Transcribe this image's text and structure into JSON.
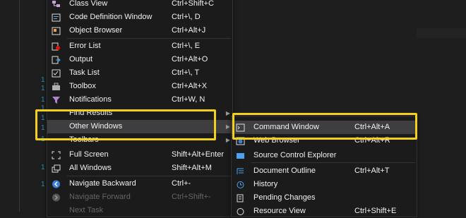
{
  "editor": {
    "line_markers": [
      "1",
      "1",
      "1",
      "1",
      "1",
      "1",
      "1",
      "1",
      "1"
    ]
  },
  "main_menu": {
    "items": [
      {
        "label": "Class View",
        "shortcut": "Ctrl+Shift+C",
        "icon": "class-view-icon"
      },
      {
        "label": "Code Definition Window",
        "shortcut": "Ctrl+\\, D",
        "icon": "code-definition-icon"
      },
      {
        "label": "Object Browser",
        "shortcut": "Ctrl+Alt+J",
        "icon": "object-browser-icon"
      },
      {
        "label": "Error List",
        "shortcut": "Ctrl+\\, E",
        "icon": "error-list-icon"
      },
      {
        "label": "Output",
        "shortcut": "Ctrl+Alt+O",
        "icon": "output-icon"
      },
      {
        "label": "Task List",
        "shortcut": "Ctrl+\\, T",
        "icon": "task-list-icon"
      },
      {
        "label": "Toolbox",
        "shortcut": "Ctrl+Alt+X",
        "icon": "toolbox-icon"
      },
      {
        "label": "Notifications",
        "shortcut": "Ctrl+W, N",
        "icon": "notifications-icon"
      },
      {
        "label": "Find Results",
        "shortcut": "",
        "icon": ""
      },
      {
        "label": "Other Windows",
        "shortcut": "",
        "icon": ""
      },
      {
        "label": "Toolbars",
        "shortcut": "",
        "icon": ""
      },
      {
        "label": "Full Screen",
        "shortcut": "Shift+Alt+Enter",
        "icon": "full-screen-icon"
      },
      {
        "label": "All Windows",
        "shortcut": "Shift+Alt+M",
        "icon": "all-windows-icon"
      },
      {
        "label": "Navigate Backward",
        "shortcut": "Ctrl+-",
        "icon": "navigate-backward-icon"
      },
      {
        "label": "Navigate Forward",
        "shortcut": "Ctrl+Shift+-",
        "icon": "navigate-forward-icon"
      },
      {
        "label": "Next Task",
        "shortcut": "",
        "icon": ""
      }
    ]
  },
  "sub_menu": {
    "items": [
      {
        "label": "Command Window",
        "shortcut": "Ctrl+Alt+A",
        "icon": "command-window-icon"
      },
      {
        "label": "Web Browser",
        "shortcut": "Ctrl+Alt+R",
        "icon": "web-browser-icon"
      },
      {
        "label": "Source Control Explorer",
        "shortcut": "",
        "icon": "source-control-explorer-icon"
      },
      {
        "label": "Document Outline",
        "shortcut": "Ctrl+Alt+T",
        "icon": "document-outline-icon"
      },
      {
        "label": "History",
        "shortcut": "",
        "icon": "history-icon"
      },
      {
        "label": "Pending Changes",
        "shortcut": "",
        "icon": "pending-changes-icon"
      },
      {
        "label": "Resource View",
        "shortcut": "Ctrl+Shift+E",
        "icon": "resource-view-icon"
      }
    ]
  },
  "colors": {
    "highlight": "#f2d01c",
    "menu_bg": "#1b1b1c",
    "hover_bg": "#3e3e40",
    "text": "#f1f1f1",
    "disabled_text": "#656565"
  }
}
